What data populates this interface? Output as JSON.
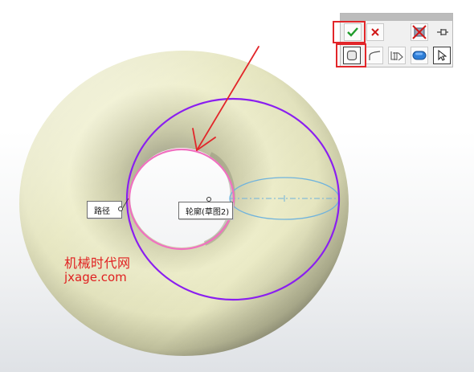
{
  "viewport": {
    "callouts": {
      "path_label": "路径",
      "profile_label": "轮廓(草图2)"
    },
    "watermark": {
      "line1": "机械时代网",
      "line2": "jxage.com"
    },
    "colors": {
      "background": "#ffffff",
      "torus_body": "#eeeecb",
      "path_circle": "#8a1ef0",
      "profile_circle": "#f070c0",
      "section_ellipse": "#6fb3dd",
      "annotation_red": "#e2262a"
    }
  },
  "toolbar": {
    "row1": [
      {
        "id": "ok",
        "icon": "checkmark-icon",
        "tooltip": ""
      },
      {
        "id": "cancel",
        "icon": "x-icon",
        "tooltip": ""
      },
      {
        "id": "hide-preview",
        "icon": "no-preview-icon",
        "tooltip": ""
      },
      {
        "id": "pin",
        "icon": "pushpin-icon",
        "tooltip": ""
      }
    ],
    "row2": [
      {
        "id": "closed-profile",
        "icon": "rounded-square-icon",
        "selected": true
      },
      {
        "id": "open-path",
        "icon": "path-curve-icon",
        "selected": false
      },
      {
        "id": "sweep-feature",
        "icon": "sweep-feature-icon",
        "selected": false
      },
      {
        "id": "solid-body",
        "icon": "solid-body-icon",
        "selected": false
      },
      {
        "id": "select",
        "icon": "arrow-cursor-icon",
        "selected": true
      }
    ]
  }
}
